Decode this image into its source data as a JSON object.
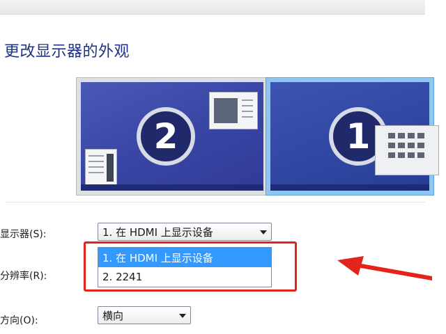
{
  "heading": "更改显示器的外观",
  "monitors": [
    {
      "number": "2",
      "state": "inactive"
    },
    {
      "number": "1",
      "state": "selected"
    }
  ],
  "display_row": {
    "label": "显示器(S):",
    "selected_value": "1. 在 HDMI 上显示设备"
  },
  "display_options": [
    {
      "label": "1. 在 HDMI 上显示设备",
      "highlighted": true
    },
    {
      "label": "2. 2241",
      "highlighted": false
    }
  ],
  "resolution_row": {
    "label": "分辨率(R):"
  },
  "orientation_row": {
    "label": "方向(O):",
    "selected_value": "横向"
  },
  "annotation": {
    "box_color": "#e3241d",
    "arrow_color": "#e3241d"
  }
}
